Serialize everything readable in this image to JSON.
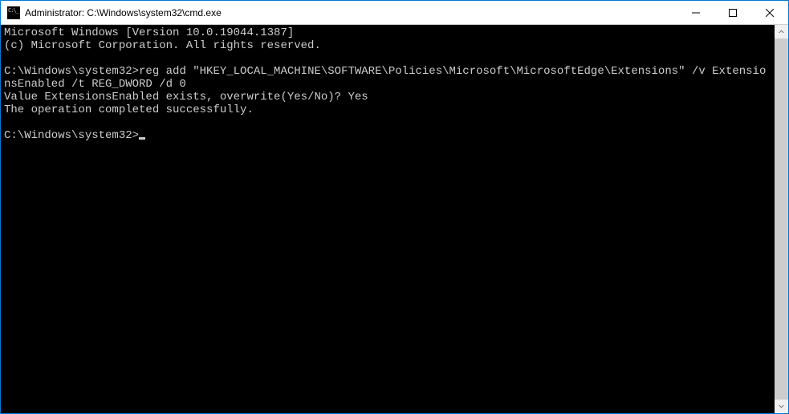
{
  "window": {
    "title": "Administrator: C:\\Windows\\system32\\cmd.exe"
  },
  "terminal": {
    "line1": "Microsoft Windows [Version 10.0.19044.1387]",
    "line2": "(c) Microsoft Corporation. All rights reserved.",
    "blank1": "",
    "prompt1": "C:\\Windows\\system32>",
    "cmd1": "reg add \"HKEY_LOCAL_MACHINE\\SOFTWARE\\Policies\\Microsoft\\MicrosoftEdge\\Extensions\" /v ExtensionsEnabled /t REG_DWORD /d 0",
    "line4": "Value ExtensionsEnabled exists, overwrite(Yes/No)? Yes",
    "line5": "The operation completed successfully.",
    "blank2": "",
    "prompt2": "C:\\Windows\\system32>"
  }
}
